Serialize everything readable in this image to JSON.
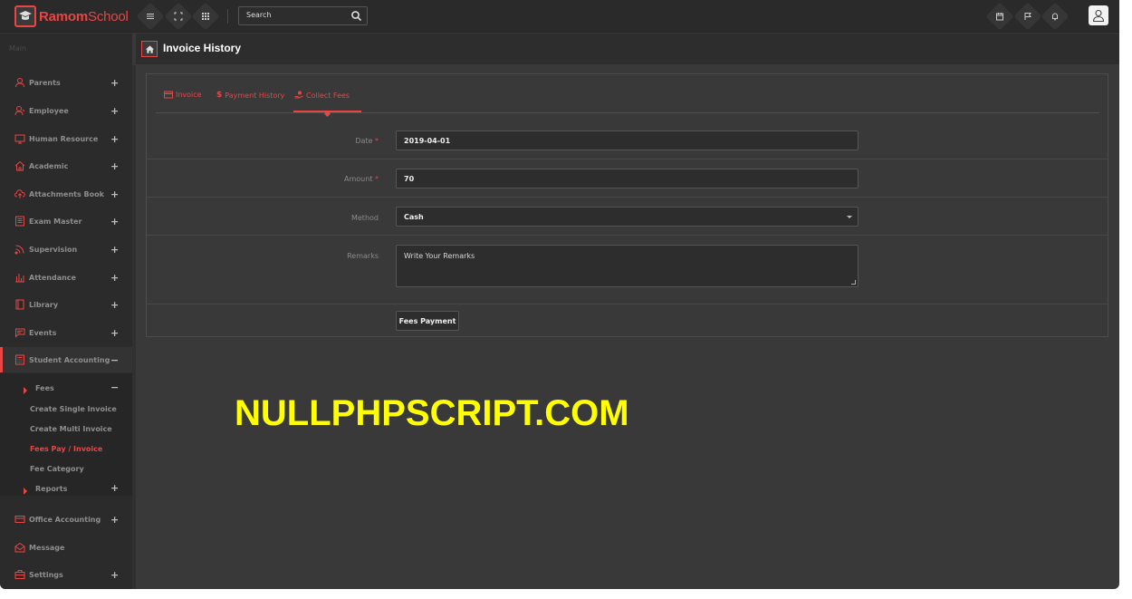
{
  "app": {
    "brand_bold": "Ramom",
    "brand_light": "School",
    "accent_color": "#e84545",
    "background_color": "#393939"
  },
  "header": {
    "search_placeholder": "Search",
    "left_icons": [
      "menu-icon",
      "fullscreen-icon",
      "apps-grid-icon"
    ],
    "right_icons": [
      "calendar-icon",
      "flag-icon",
      "bell-icon",
      "user-avatar-icon"
    ]
  },
  "sidebar": {
    "caption": "Main",
    "items": [
      {
        "label": "Parents",
        "icon": "parents-icon",
        "toggle": "+"
      },
      {
        "label": "Employee",
        "icon": "employee-icon",
        "toggle": "+"
      },
      {
        "label": "Human Resource",
        "icon": "monitor-icon",
        "toggle": "+"
      },
      {
        "label": "Academic",
        "icon": "home-icon",
        "toggle": "+"
      },
      {
        "label": "Attachments Book",
        "icon": "cloud-upload-icon",
        "toggle": "+"
      },
      {
        "label": "Exam Master",
        "icon": "book-icon",
        "toggle": "+"
      },
      {
        "label": "Supervision",
        "icon": "feed-icon",
        "toggle": "+"
      },
      {
        "label": "Attendance",
        "icon": "bar-chart-icon",
        "toggle": "+"
      },
      {
        "label": "Library",
        "icon": "library-icon",
        "toggle": "+"
      },
      {
        "label": "Events",
        "icon": "message-icon",
        "toggle": "+"
      },
      {
        "label": "Student Accounting",
        "icon": "calculator-icon",
        "toggle": "−"
      },
      {
        "label": "Office Accounting",
        "icon": "credit-card-icon",
        "toggle": "+"
      },
      {
        "label": "Message",
        "icon": "envelope-icon",
        "toggle": ""
      },
      {
        "label": "Settings",
        "icon": "toolbox-icon",
        "toggle": "+"
      }
    ],
    "submenu": {
      "group_label": "Fees",
      "group_toggle": "−",
      "items": [
        "Create Single Invoice",
        "Create Multi Invoice",
        "Fees Pay / Invoice",
        "Fee Category"
      ],
      "active_item": "Fees Pay / Invoice",
      "reports_label": "Reports",
      "reports_toggle": "+"
    }
  },
  "page": {
    "title": "Invoice History",
    "tabs": [
      {
        "label": "Invoice",
        "icon": "invoice-icon"
      },
      {
        "label": "Payment History",
        "icon": "dollar-icon"
      },
      {
        "label": "Collect Fees",
        "icon": "hand-coin-icon",
        "active": true
      }
    ],
    "form": {
      "date_label": "Date",
      "date_value": "2019-04-01",
      "amount_label": "Amount",
      "amount_value": "70",
      "required_mark": "*",
      "method_label": "Method",
      "method_value": "Cash",
      "remarks_label": "Remarks",
      "remarks_placeholder": "Write Your Remarks",
      "submit_label": "Fees Payment"
    }
  },
  "watermark": "NULLPHPSCRIPT.COM"
}
